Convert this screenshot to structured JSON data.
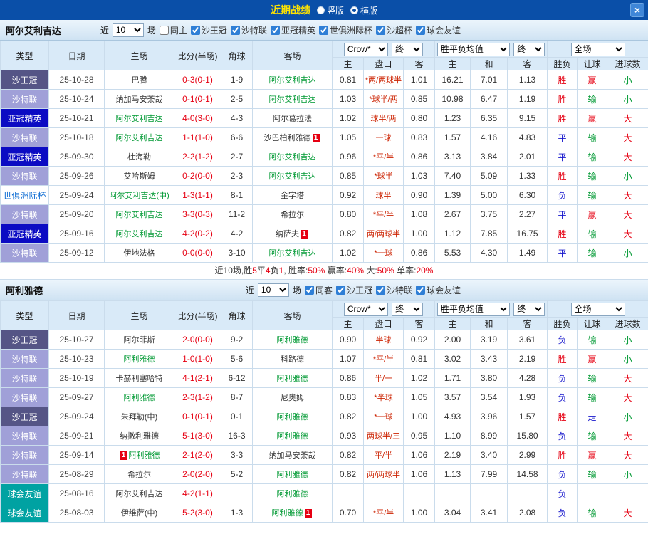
{
  "topbar": {
    "title": "近期战绩",
    "radio_vertical": "竖版",
    "radio_horizontal": "横版",
    "close": "×"
  },
  "table_headers": {
    "type": "类型",
    "date": "日期",
    "home": "主场",
    "score": "比分(半场)",
    "corner": "角球",
    "away": "客场",
    "h": "主",
    "handicap": "盘口",
    "a": "客",
    "w": "主",
    "d": "和",
    "l": "客",
    "res": "胜负",
    "hc": "让球",
    "goals": "进球数"
  },
  "colors": {
    "topbar_bg": "#0a4fa8",
    "topbar_title": "#ffe400",
    "accent": "#2f7fd6",
    "score": "#e60012",
    "handicap_line": "#cc2200",
    "focus_team": "#009933",
    "type_bg": {
      "沙王冠": "#555586",
      "沙特联": "#a0a0d8",
      "亚冠精英": "#0b0bc3",
      "世俱洲际杯": "#ffffff",
      "球会友谊": "#00a2a2"
    },
    "type_fg": {
      "世俱洲际杯": "#0b6bd3"
    },
    "result": {
      "胜": "#e60012",
      "平": "#1515cc",
      "负": "#1515cc"
    },
    "hc_result": {
      "赢": "#e60012",
      "输": "#009933",
      "走": "#1515cc"
    },
    "goals_result": {
      "大": "#e60012",
      "小": "#009933"
    }
  },
  "sections": [
    {
      "team": "阿尔艾利吉达",
      "filter": {
        "near": "近",
        "count": "10",
        "games": "场",
        "same": {
          "label": "同主",
          "checked": false
        },
        "leagues": [
          {
            "label": "沙王冠",
            "checked": true
          },
          {
            "label": "沙特联",
            "checked": true
          },
          {
            "label": "亚冠精英",
            "checked": true
          },
          {
            "label": "世俱洲际杯",
            "checked": true
          },
          {
            "label": "沙超杯",
            "checked": true
          },
          {
            "label": "球会友谊",
            "checked": true
          }
        ]
      },
      "selects": {
        "bookmaker": "Crow*",
        "time1": "终",
        "avg": "胜平负均值",
        "time2": "终",
        "scope": "全场"
      },
      "rows": [
        {
          "type": "沙王冠",
          "date": "25-10-28",
          "home": "巴腾",
          "score": "0-3(0-1)",
          "corner": "1-9",
          "away": "阿尔艾利吉达",
          "h": "0.81",
          "handicap": "*两/两球半",
          "a": "1.01",
          "w": "16.21",
          "d": "7.01",
          "l": "1.13",
          "res": "胜",
          "hc": "赢",
          "goals": "小"
        },
        {
          "type": "沙特联",
          "date": "25-10-24",
          "home": "纳加马安荼哉",
          "score": "0-1(0-1)",
          "corner": "2-5",
          "away": "阿尔艾利吉达",
          "h": "1.03",
          "handicap": "*球半/两",
          "a": "0.85",
          "w": "10.98",
          "d": "6.47",
          "l": "1.19",
          "res": "胜",
          "hc": "输",
          "goals": "小"
        },
        {
          "type": "亚冠精英",
          "date": "25-10-21",
          "home": "阿尔艾利吉达",
          "score": "4-0(3-0)",
          "corner": "4-3",
          "away": "阿尔葛拉法",
          "h": "1.02",
          "handicap": "球半/两",
          "a": "0.80",
          "w": "1.23",
          "d": "6.35",
          "l": "9.15",
          "res": "胜",
          "hc": "赢",
          "goals": "大"
        },
        {
          "type": "沙特联",
          "date": "25-10-18",
          "home": "阿尔艾利吉达",
          "score": "1-1(1-0)",
          "corner": "6-6",
          "away": "沙巴柏利雅德",
          "away_rc_after": "1",
          "h": "1.05",
          "handicap": "一球",
          "a": "0.83",
          "w": "1.57",
          "d": "4.16",
          "l": "4.83",
          "res": "平",
          "hc": "输",
          "goals": "大"
        },
        {
          "type": "亚冠精英",
          "date": "25-09-30",
          "home": "杜海勒",
          "score": "2-2(1-2)",
          "corner": "2-7",
          "away": "阿尔艾利吉达",
          "h": "0.96",
          "handicap": "*平/半",
          "a": "0.86",
          "w": "3.13",
          "d": "3.84",
          "l": "2.01",
          "res": "平",
          "hc": "输",
          "goals": "大"
        },
        {
          "type": "沙特联",
          "date": "25-09-26",
          "home": "艾哈斯姆",
          "score": "0-2(0-0)",
          "corner": "2-3",
          "away": "阿尔艾利吉达",
          "h": "0.85",
          "handicap": "*球半",
          "a": "1.03",
          "w": "7.40",
          "d": "5.09",
          "l": "1.33",
          "res": "胜",
          "hc": "输",
          "goals": "小"
        },
        {
          "type": "世俱洲际杯",
          "date": "25-09-24",
          "home": "阿尔艾利吉达(中)",
          "score": "1-3(1-1)",
          "corner": "8-1",
          "away": "金字塔",
          "h": "0.92",
          "handicap": "球半",
          "a": "0.90",
          "w": "1.39",
          "d": "5.00",
          "l": "6.30",
          "res": "负",
          "hc": "输",
          "goals": "大"
        },
        {
          "type": "沙特联",
          "date": "25-09-20",
          "home": "阿尔艾利吉达",
          "score": "3-3(0-3)",
          "corner": "11-2",
          "away": "希拉尔",
          "h": "0.80",
          "handicap": "*平/半",
          "a": "1.08",
          "w": "2.67",
          "d": "3.75",
          "l": "2.27",
          "res": "平",
          "hc": "赢",
          "goals": "大"
        },
        {
          "type": "亚冠精英",
          "date": "25-09-16",
          "home": "阿尔艾利吉达",
          "score": "4-2(0-2)",
          "corner": "4-2",
          "away": "纳萨夫",
          "away_rc_after": "1",
          "h": "0.82",
          "handicap": "两/两球半",
          "a": "1.00",
          "w": "1.12",
          "d": "7.85",
          "l": "16.75",
          "res": "胜",
          "hc": "输",
          "goals": "大"
        },
        {
          "type": "沙特联",
          "date": "25-09-12",
          "home": "伊地法格",
          "score": "0-0(0-0)",
          "corner": "3-10",
          "away": "阿尔艾利吉达",
          "h": "1.02",
          "handicap": "*一球",
          "a": "0.86",
          "w": "5.53",
          "d": "4.30",
          "l": "1.49",
          "res": "平",
          "hc": "输",
          "goals": "小"
        }
      ],
      "summary": [
        {
          "text": "近10场,胜",
          "color": "#333333"
        },
        {
          "text": "5",
          "color": "#e60012"
        },
        {
          "text": "平",
          "color": "#333333"
        },
        {
          "text": "4",
          "color": "#e60012"
        },
        {
          "text": "负",
          "color": "#333333"
        },
        {
          "text": "1",
          "color": "#e60012"
        },
        {
          "text": ", 胜率:",
          "color": "#333333"
        },
        {
          "text": "50%",
          "color": "#e60012"
        },
        {
          "text": " 赢率:",
          "color": "#333333"
        },
        {
          "text": "40%",
          "color": "#e60012"
        },
        {
          "text": " 大:",
          "color": "#333333"
        },
        {
          "text": "50%",
          "color": "#e60012"
        },
        {
          "text": " 单率:",
          "color": "#333333"
        },
        {
          "text": "20%",
          "color": "#e60012"
        }
      ]
    },
    {
      "team": "阿利雅德",
      "filter": {
        "near": "近",
        "count": "10",
        "games": "场",
        "same": {
          "label": "同客",
          "checked": true
        },
        "leagues": [
          {
            "label": "沙王冠",
            "checked": true
          },
          {
            "label": "沙特联",
            "checked": true
          },
          {
            "label": "球会友谊",
            "checked": true
          }
        ]
      },
      "selects": {
        "bookmaker": "Crow*",
        "time1": "终",
        "avg": "胜平负均值",
        "time2": "终",
        "scope": "全场"
      },
      "rows": [
        {
          "type": "沙王冠",
          "date": "25-10-27",
          "home": "阿尔菲斯",
          "score": "2-0(0-0)",
          "corner": "9-2",
          "away": "阿利雅德",
          "h": "0.90",
          "handicap": "半球",
          "a": "0.92",
          "w": "2.00",
          "d": "3.19",
          "l": "3.61",
          "res": "负",
          "hc": "输",
          "goals": "小"
        },
        {
          "type": "沙特联",
          "date": "25-10-23",
          "home": "阿利雅德",
          "score": "1-0(1-0)",
          "corner": "5-6",
          "away": "科路德",
          "h": "1.07",
          "handicap": "*平/半",
          "a": "0.81",
          "w": "3.02",
          "d": "3.43",
          "l": "2.19",
          "res": "胜",
          "hc": "赢",
          "goals": "小"
        },
        {
          "type": "沙特联",
          "date": "25-10-19",
          "home": "卡赫利塞哈特",
          "score": "4-1(2-1)",
          "corner": "6-12",
          "away": "阿利雅德",
          "h": "0.86",
          "handicap": "半/一",
          "a": "1.02",
          "w": "1.71",
          "d": "3.80",
          "l": "4.28",
          "res": "负",
          "hc": "输",
          "goals": "大"
        },
        {
          "type": "沙特联",
          "date": "25-09-27",
          "home": "阿利雅德",
          "score": "2-3(1-2)",
          "corner": "8-7",
          "away": "尼奥姆",
          "h": "0.83",
          "handicap": "*半球",
          "a": "1.05",
          "w": "3.57",
          "d": "3.54",
          "l": "1.93",
          "res": "负",
          "hc": "输",
          "goals": "大"
        },
        {
          "type": "沙王冠",
          "date": "25-09-24",
          "home": "朱拜勒(中)",
          "score": "0-1(0-1)",
          "corner": "0-1",
          "away": "阿利雅德",
          "h": "0.82",
          "handicap": "*一球",
          "a": "1.00",
          "w": "4.93",
          "d": "3.96",
          "l": "1.57",
          "res": "胜",
          "hc": "走",
          "goals": "小"
        },
        {
          "type": "沙特联",
          "date": "25-09-21",
          "home": "纳撒利雅德",
          "score": "5-1(3-0)",
          "corner": "16-3",
          "away": "阿利雅德",
          "h": "0.93",
          "handicap": "两球半/三",
          "a": "0.95",
          "w": "1.10",
          "d": "8.99",
          "l": "15.80",
          "res": "负",
          "hc": "输",
          "goals": "大"
        },
        {
          "type": "沙特联",
          "date": "25-09-14",
          "home": "阿利雅德",
          "home_rc_before": "1",
          "score": "2-1(2-0)",
          "corner": "3-3",
          "away": "纳加马安荼哉",
          "h": "0.82",
          "handicap": "平/半",
          "a": "1.06",
          "w": "2.19",
          "d": "3.40",
          "l": "2.99",
          "res": "胜",
          "hc": "赢",
          "goals": "大"
        },
        {
          "type": "沙特联",
          "date": "25-08-29",
          "home": "希拉尔",
          "score": "2-0(2-0)",
          "corner": "5-2",
          "away": "阿利雅德",
          "h": "0.82",
          "handicap": "两/两球半",
          "a": "1.06",
          "w": "1.13",
          "d": "7.99",
          "l": "14.58",
          "res": "负",
          "hc": "输",
          "goals": "小"
        },
        {
          "type": "球会友谊",
          "date": "25-08-16",
          "home": "阿尔艾利吉达",
          "score": "4-2(1-1)",
          "corner": "",
          "away": "阿利雅德",
          "h": "",
          "handicap": "",
          "a": "",
          "w": "",
          "d": "",
          "l": "",
          "res": "负",
          "hc": "",
          "goals": ""
        },
        {
          "type": "球会友谊",
          "date": "25-08-03",
          "home": "伊维萨(中)",
          "score": "5-2(3-0)",
          "corner": "1-3",
          "away": "阿利雅德",
          "away_rc_after": "1",
          "h": "0.70",
          "handicap": "*平/半",
          "a": "1.00",
          "w": "3.04",
          "d": "3.41",
          "l": "2.08",
          "res": "负",
          "hc": "输",
          "goals": "大"
        }
      ]
    }
  ]
}
